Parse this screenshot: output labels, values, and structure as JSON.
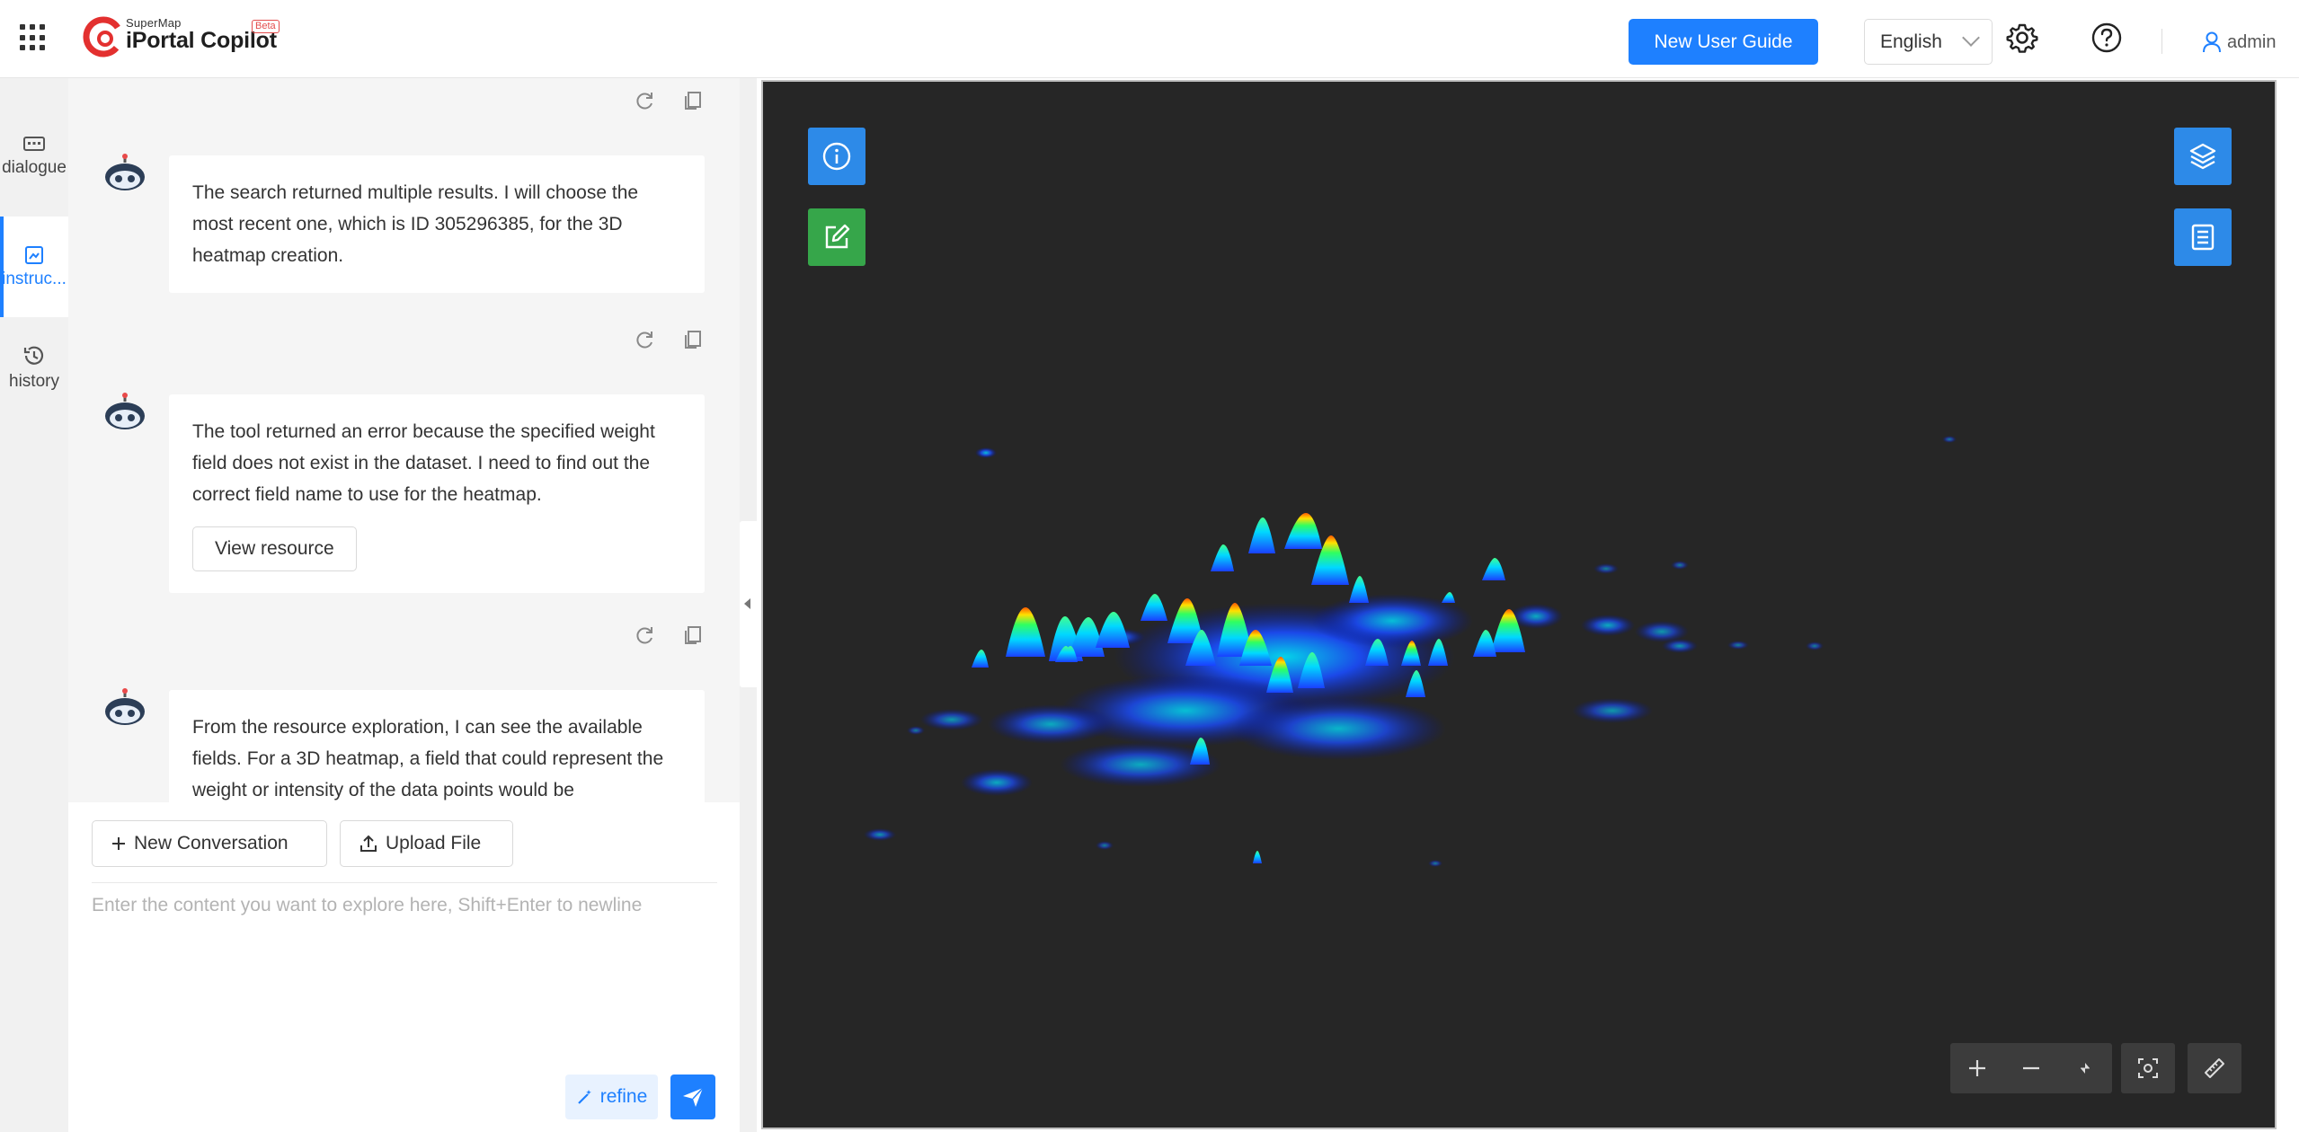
{
  "header": {
    "brand_small": "SuperMap",
    "brand_main": "iPortal Copilot",
    "beta_label": "Beta",
    "guide_label": "New User Guide",
    "language": "English",
    "user_name": "admin"
  },
  "nav": {
    "items": [
      {
        "label": "dialogue",
        "icon": "dialogue-icon"
      },
      {
        "label": "instruc...",
        "icon": "instruction-icon"
      },
      {
        "label": "history",
        "icon": "history-icon"
      }
    ]
  },
  "chat": {
    "messages": [
      {
        "text": "The search returned multiple results. I will choose the most recent one, which is ID 305296385, for the 3D heatmap creation."
      },
      {
        "text": "The tool returned an error because the specified weight field does not exist in the dataset. I need to find out the correct field name to use for the heatmap.",
        "action_label": "View resource"
      },
      {
        "text": "From the resource exploration, I can see the available fields. For a 3D heatmap, a field that could represent the weight or intensity of the data points would be"
      }
    ]
  },
  "composer": {
    "new_conversation_label": "New Conversation",
    "upload_label": "Upload File",
    "placeholder": "Enter the content you want to explore here, Shift+Enter to newline",
    "refine_label": "refine"
  },
  "colors": {
    "accent": "#1e80ff",
    "map_bg": "#262626",
    "edit_green": "#36a64a"
  }
}
